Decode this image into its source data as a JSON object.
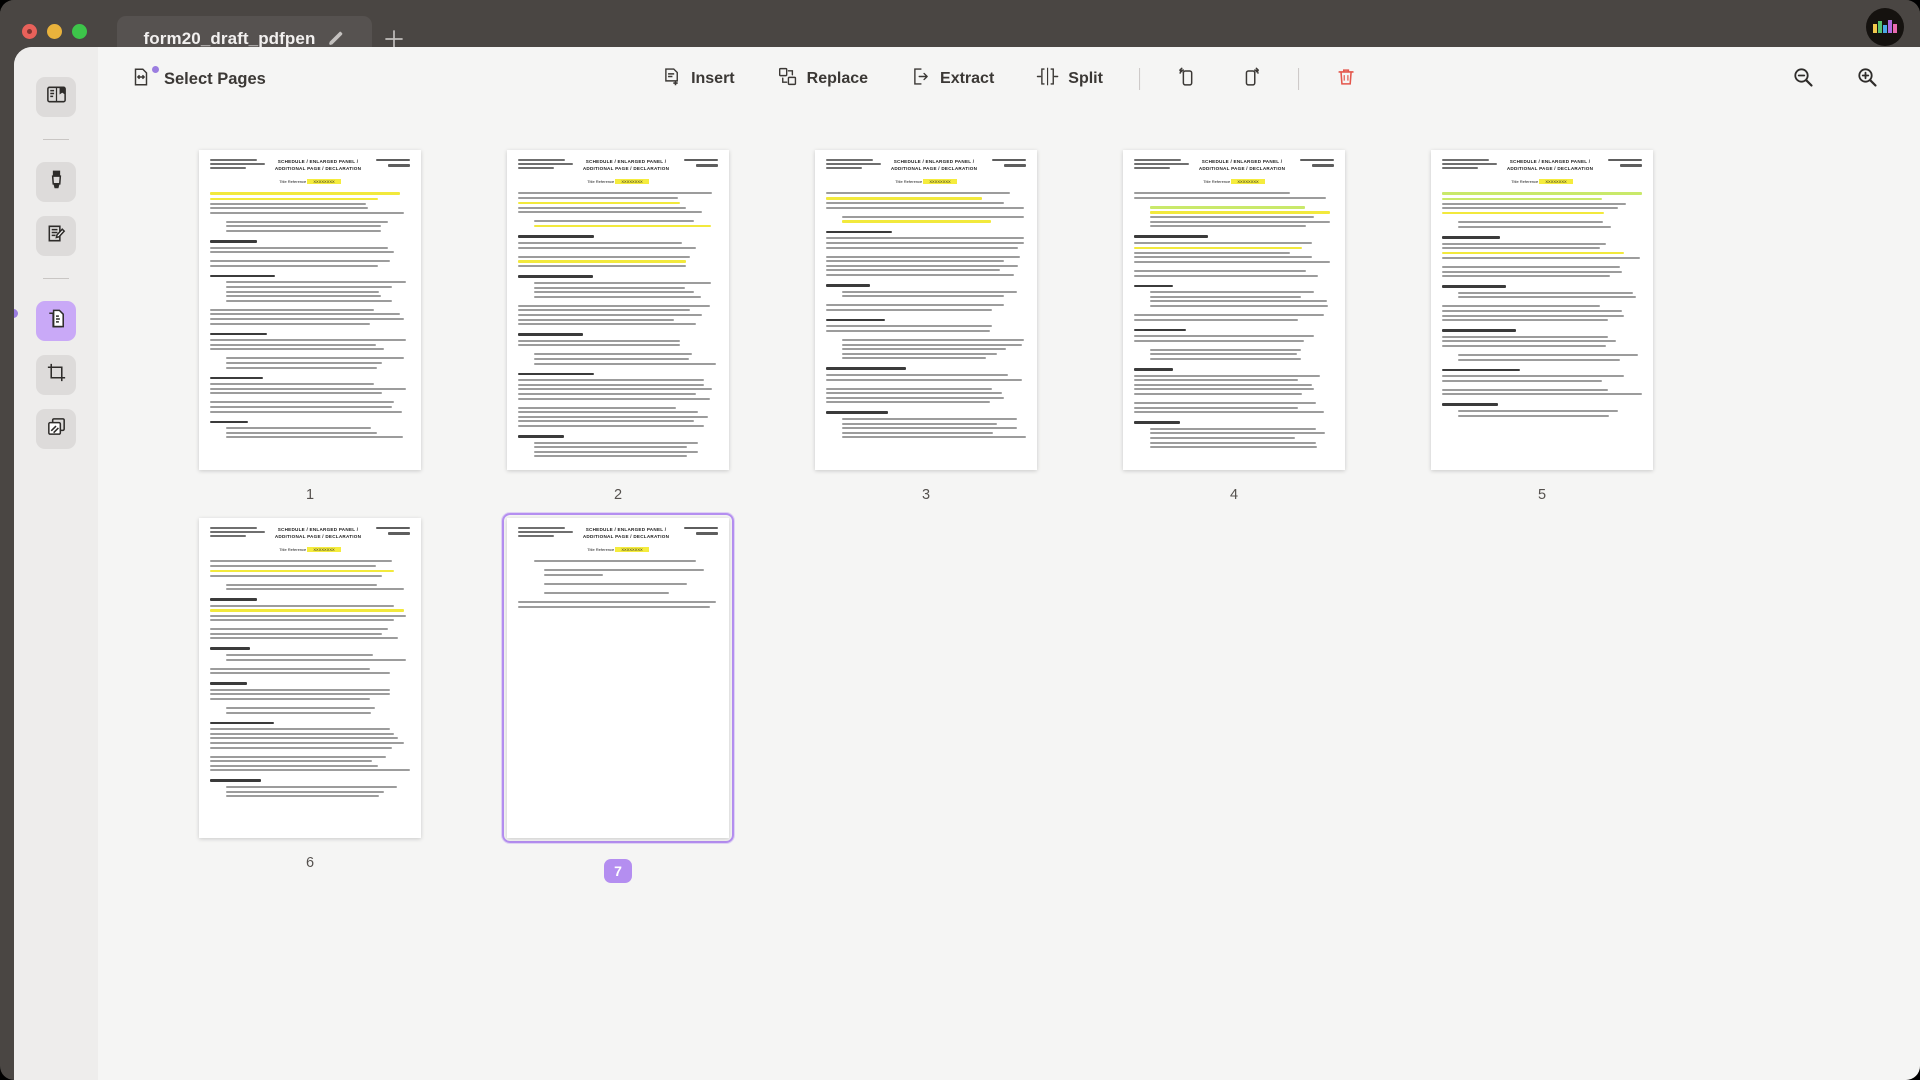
{
  "window": {
    "traffic_lights": [
      "close",
      "minimize",
      "zoom"
    ],
    "tab_title": "form20_draft_pdfpen",
    "new_tab_label": "+",
    "brand_colors": [
      "#f2c94c",
      "#56c271",
      "#4aa8e8",
      "#b06ae0",
      "#e86ab0"
    ]
  },
  "sidebar": {
    "items": [
      {
        "name": "reader-view",
        "icon": "book-icon",
        "active": false
      },
      {
        "name": "highlight-tool",
        "icon": "highlighter-icon",
        "active": false
      },
      {
        "name": "sign-tool",
        "icon": "sign-document-icon",
        "active": false
      },
      {
        "name": "pages-tool",
        "icon": "pages-icon",
        "active": true
      },
      {
        "name": "crop-tool",
        "icon": "crop-icon",
        "active": false
      },
      {
        "name": "stamp-tool",
        "icon": "layers-icon",
        "active": false
      }
    ]
  },
  "toolbar": {
    "mode_label": "Select Pages",
    "mode_icon": "select-pages-icon",
    "has_badge_dot": true,
    "actions": [
      {
        "label": "Insert",
        "icon": "insert-page-icon"
      },
      {
        "label": "Replace",
        "icon": "replace-page-icon"
      },
      {
        "label": "Extract",
        "icon": "extract-page-icon"
      },
      {
        "label": "Split",
        "icon": "split-page-icon"
      }
    ],
    "rotate_left": {
      "label": "",
      "icon": "rotate-left-icon"
    },
    "rotate_right": {
      "label": "",
      "icon": "rotate-right-icon"
    },
    "delete": {
      "label": "",
      "icon": "trash-icon",
      "color": "#e4564b"
    },
    "zoom_out": {
      "label": "",
      "icon": "zoom-out-icon"
    },
    "zoom_in": {
      "label": "",
      "icon": "zoom-in-icon"
    }
  },
  "document": {
    "header_title_line1": "SCHEDULE / ENLARGED PANEL /",
    "header_title_line2": "ADDITIONAL PAGE / DECLARATION",
    "title_reference_label": "Title Reference",
    "title_reference_value": "XXXXXXXX",
    "form_label": "Form 20",
    "form_version": "Version 2"
  },
  "pages": [
    {
      "number": "1",
      "page_of": "Page 2 of 8",
      "selected": false
    },
    {
      "number": "2",
      "page_of": "Page 3 of 8",
      "selected": false
    },
    {
      "number": "3",
      "page_of": "Page 4 of 8",
      "selected": false
    },
    {
      "number": "4",
      "page_of": "Page 5 of 8",
      "selected": false
    },
    {
      "number": "5",
      "page_of": "Page 6 of 8",
      "selected": false
    },
    {
      "number": "6",
      "page_of": "Page 7 of 8",
      "selected": false
    },
    {
      "number": "7",
      "page_of": "Page 8 of 8",
      "selected": true
    }
  ],
  "colors": {
    "window_chrome": "#4a4643",
    "sheet_bg": "#f5f5f4",
    "rail_bg": "#eeedec",
    "accent_purple": "#b48ef0",
    "accent_purple_soft": "#c9a9f7",
    "delete_red": "#e4564b",
    "highlight_yellow": "#f2e93c",
    "highlight_green": "#c9e96a"
  }
}
